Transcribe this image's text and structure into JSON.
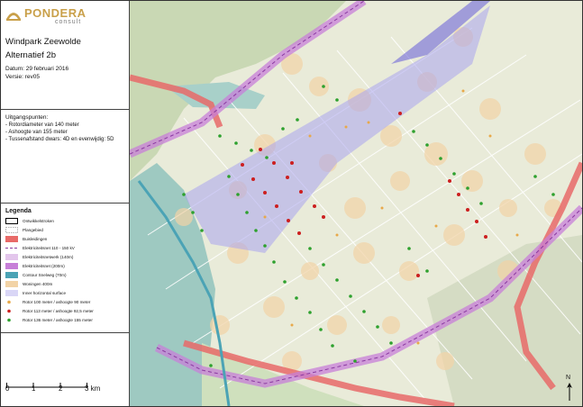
{
  "header": {
    "logo_name": "PONDERA",
    "logo_sub": "consult",
    "title": "Windpark Zeewolde",
    "subtitle": "Alternatief 2b",
    "date": "Datum: 29 februari 2016",
    "version": "Versie: rev05"
  },
  "assumptions": {
    "heading": "Uitgangspunten:",
    "lines": [
      "- Rotordiameter van 140 meter",
      "- Ashoogte van 155 meter",
      "- Tussenafstand dwars: 4D en evenwijdig: 5D"
    ]
  },
  "legend": {
    "heading": "Legenda",
    "items": [
      {
        "label": "Ontwikkelstroken",
        "symbol": "outline-black"
      },
      {
        "label": "Plangebied",
        "symbol": "outline-dashed"
      },
      {
        "label": "Buisleidingen",
        "symbol": "fill-red"
      },
      {
        "label": "Elektriciteitsnet 110 - 150 kV",
        "symbol": "line-dashed"
      },
      {
        "label": "Elektriciteitsnetwerk (140m)",
        "symbol": "fill-lightpurple"
      },
      {
        "label": "Elektriciteitsnet (200m)",
        "symbol": "fill-purple"
      },
      {
        "label": "Contour Snelweg (70m)",
        "symbol": "fill-teal"
      },
      {
        "label": "Woningen 400m",
        "symbol": "fill-peach"
      },
      {
        "label": "Inner horizontal surface",
        "symbol": "fill-lavender"
      },
      {
        "label": "Rotor 100 meter / ashoogte 90 meter",
        "symbol": "dot-orange"
      },
      {
        "label": "Rotor 113 meter / ashoogte 92,5 meter",
        "symbol": "dot-red"
      },
      {
        "label": "Rotor 136 meter / ashoogte 155 meter",
        "symbol": "dot-green"
      }
    ]
  },
  "scale": {
    "ticks": [
      "0",
      "1",
      "2",
      "3 km"
    ]
  },
  "north": {
    "label": "N"
  },
  "colors": {
    "pipeline_red": "#e86a68",
    "power_purple": "#c77fd8",
    "inner_surface": "#a9a4ee",
    "highway_teal": "#4ba3b5",
    "house_buffer": "#f2d3a6",
    "water_green": "#7fb6a4",
    "turbine_green": "#2ea12e",
    "turbine_red": "#cc1f1f",
    "turbine_orange": "#e8a94a"
  }
}
